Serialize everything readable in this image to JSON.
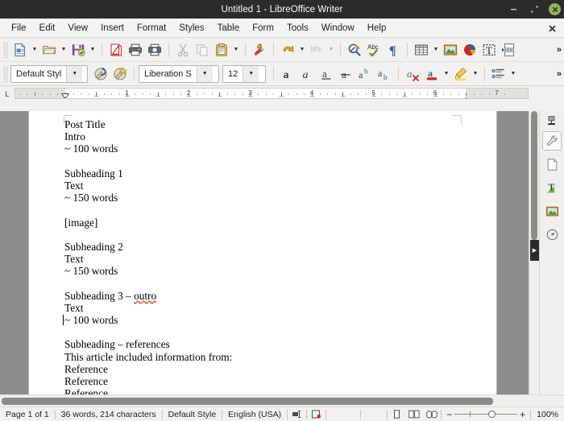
{
  "window": {
    "title": "Untitled 1 - LibreOffice Writer",
    "minimize_label": "—",
    "maximize_label": "❐",
    "close_label": "✕"
  },
  "menubar": {
    "items": [
      {
        "label": "File"
      },
      {
        "label": "Edit"
      },
      {
        "label": "View"
      },
      {
        "label": "Insert"
      },
      {
        "label": "Format"
      },
      {
        "label": "Styles"
      },
      {
        "label": "Table"
      },
      {
        "label": "Form"
      },
      {
        "label": "Tools"
      },
      {
        "label": "Window"
      },
      {
        "label": "Help"
      }
    ],
    "close_document_label": "✕"
  },
  "standard_toolbar": {
    "overflow_label": "»",
    "buttons": [
      {
        "name": "new-doc-icon",
        "title": "New"
      },
      {
        "name": "new-doc-dropdown",
        "title": "New dropdown"
      },
      {
        "name": "open-folder-icon",
        "title": "Open"
      },
      {
        "name": "open-dropdown",
        "title": "Open dropdown"
      },
      {
        "name": "save-icon",
        "title": "Save"
      },
      {
        "name": "save-dropdown",
        "title": "Save dropdown"
      },
      {
        "name": "export-pdf-icon",
        "title": "Export as PDF"
      },
      {
        "name": "print-icon",
        "title": "Print"
      },
      {
        "name": "print-preview-icon",
        "title": "Print Preview"
      },
      {
        "name": "cut-icon",
        "title": "Cut"
      },
      {
        "name": "copy-icon",
        "title": "Copy"
      },
      {
        "name": "paste-icon",
        "title": "Paste"
      },
      {
        "name": "paste-dropdown",
        "title": "Paste dropdown"
      },
      {
        "name": "clone-formatting-icon",
        "title": "Clone Formatting"
      },
      {
        "name": "undo-icon",
        "title": "Undo"
      },
      {
        "name": "undo-dropdown",
        "title": "Undo dropdown"
      },
      {
        "name": "redo-icon",
        "title": "Redo"
      },
      {
        "name": "redo-dropdown",
        "title": "Redo dropdown"
      },
      {
        "name": "find-replace-icon",
        "title": "Find and Replace"
      },
      {
        "name": "spelling-icon",
        "title": "Spelling"
      },
      {
        "name": "formatting-marks-icon",
        "title": "Formatting Marks"
      },
      {
        "name": "insert-table-icon",
        "title": "Insert Table"
      },
      {
        "name": "insert-table-dropdown",
        "title": "Insert Table dropdown"
      },
      {
        "name": "insert-image-icon",
        "title": "Insert Image"
      },
      {
        "name": "insert-chart-icon",
        "title": "Insert Chart"
      },
      {
        "name": "insert-textbox-icon",
        "title": "Insert Text Box"
      },
      {
        "name": "insert-page-break-icon",
        "title": "Insert Page Break"
      }
    ]
  },
  "formatting_toolbar": {
    "overflow_label": "»",
    "paragraph_style": {
      "value": "Default Styl",
      "placeholder": "Paragraph Style"
    },
    "update_style_icon": "update-selected-style-icon",
    "new_style_icon": "new-style-from-selection-icon",
    "font_name": {
      "value": "Liberation S",
      "placeholder": "Font Name"
    },
    "font_size": {
      "value": "12",
      "placeholder": "Font Size"
    },
    "buttons": [
      {
        "name": "bold-icon",
        "glyph": "a",
        "title": "Bold"
      },
      {
        "name": "italic-icon",
        "glyph": "a",
        "title": "Italic"
      },
      {
        "name": "underline-icon",
        "glyph": "a",
        "title": "Underline"
      },
      {
        "name": "strikethrough-icon",
        "glyph": "a",
        "title": "Strikethrough"
      },
      {
        "name": "superscript-icon",
        "glyph": "ab",
        "title": "Superscript"
      },
      {
        "name": "subscript-icon",
        "glyph": "ab",
        "title": "Subscript"
      },
      {
        "name": "clear-formatting-icon",
        "glyph": "a",
        "title": "Clear Direct Formatting"
      },
      {
        "name": "font-color-icon",
        "glyph": "a",
        "title": "Font Color"
      },
      {
        "name": "font-color-dropdown",
        "title": "Font Color dropdown"
      },
      {
        "name": "highlight-color-icon",
        "title": "Highlighting Color"
      },
      {
        "name": "highlight-color-dropdown",
        "title": "Highlighting dropdown"
      },
      {
        "name": "unordered-list-icon",
        "title": "Unordered List"
      },
      {
        "name": "unordered-list-dropdown",
        "title": "Unordered List dropdown"
      }
    ]
  },
  "ruler": {
    "corner_glyph": "L",
    "numbers": [
      "1",
      "2",
      "3",
      "4",
      "5",
      "6",
      "7"
    ],
    "unit": "inch"
  },
  "document": {
    "lines": [
      {
        "text": "Post Title",
        "blank": false,
        "caret": false
      },
      {
        "text": "Intro",
        "blank": false,
        "caret": false
      },
      {
        "text": "~ 100 words",
        "blank": false,
        "caret": false
      },
      {
        "text": "",
        "blank": true,
        "caret": false
      },
      {
        "text": "Subheading 1",
        "blank": false,
        "caret": false
      },
      {
        "text": "Text",
        "blank": false,
        "caret": false
      },
      {
        "text": "~ 150 words",
        "blank": false,
        "caret": false
      },
      {
        "text": "",
        "blank": true,
        "caret": false
      },
      {
        "text": "[image]",
        "blank": false,
        "caret": false
      },
      {
        "text": "",
        "blank": true,
        "caret": false
      },
      {
        "text": "Subheading 2",
        "blank": false,
        "caret": false
      },
      {
        "text": "Text",
        "blank": false,
        "caret": false
      },
      {
        "text": "~ 150 words",
        "blank": false,
        "caret": false
      },
      {
        "text": "",
        "blank": true,
        "caret": false
      },
      {
        "text": "Subheading 3 – outro",
        "blank": false,
        "caret": false,
        "misspelled": "outro",
        "prefix": "Subheading 3 – "
      },
      {
        "text": "Text",
        "blank": false,
        "caret": false
      },
      {
        "text": "~ 100 words",
        "blank": false,
        "caret": true
      },
      {
        "text": "",
        "blank": true,
        "caret": false
      },
      {
        "text": "Subheading – references",
        "blank": false,
        "caret": false
      },
      {
        "text": "This article included information from:",
        "blank": false,
        "caret": false
      },
      {
        "text": "Reference",
        "blank": false,
        "caret": false
      },
      {
        "text": "Reference",
        "blank": false,
        "caret": false
      },
      {
        "text": "Reference",
        "blank": false,
        "caret": false
      }
    ]
  },
  "sidebar": {
    "settings_icon": "sidebar-settings-icon",
    "items": [
      {
        "name": "sidebar-properties-wrench",
        "label": "Properties"
      },
      {
        "name": "sidebar-page",
        "label": "Page"
      },
      {
        "name": "sidebar-styles",
        "label": "Styles"
      },
      {
        "name": "sidebar-gallery",
        "label": "Gallery"
      },
      {
        "name": "sidebar-navigator",
        "label": "Navigator"
      }
    ]
  },
  "statusbar": {
    "page": "Page 1 of 1",
    "word_count": "36 words, 214 characters",
    "page_style": "Default Style",
    "language": "English (USA)",
    "selection_mode_icon": "selection-mode-icon",
    "save_state_icon": "unsaved-changes-icon",
    "view_single_page": "single-page-view-icon",
    "view_multi_page": "multi-page-view-icon",
    "view_book": "book-view-icon",
    "zoom_out_label": "−",
    "zoom_in_label": "+",
    "zoom_level": "100%"
  }
}
